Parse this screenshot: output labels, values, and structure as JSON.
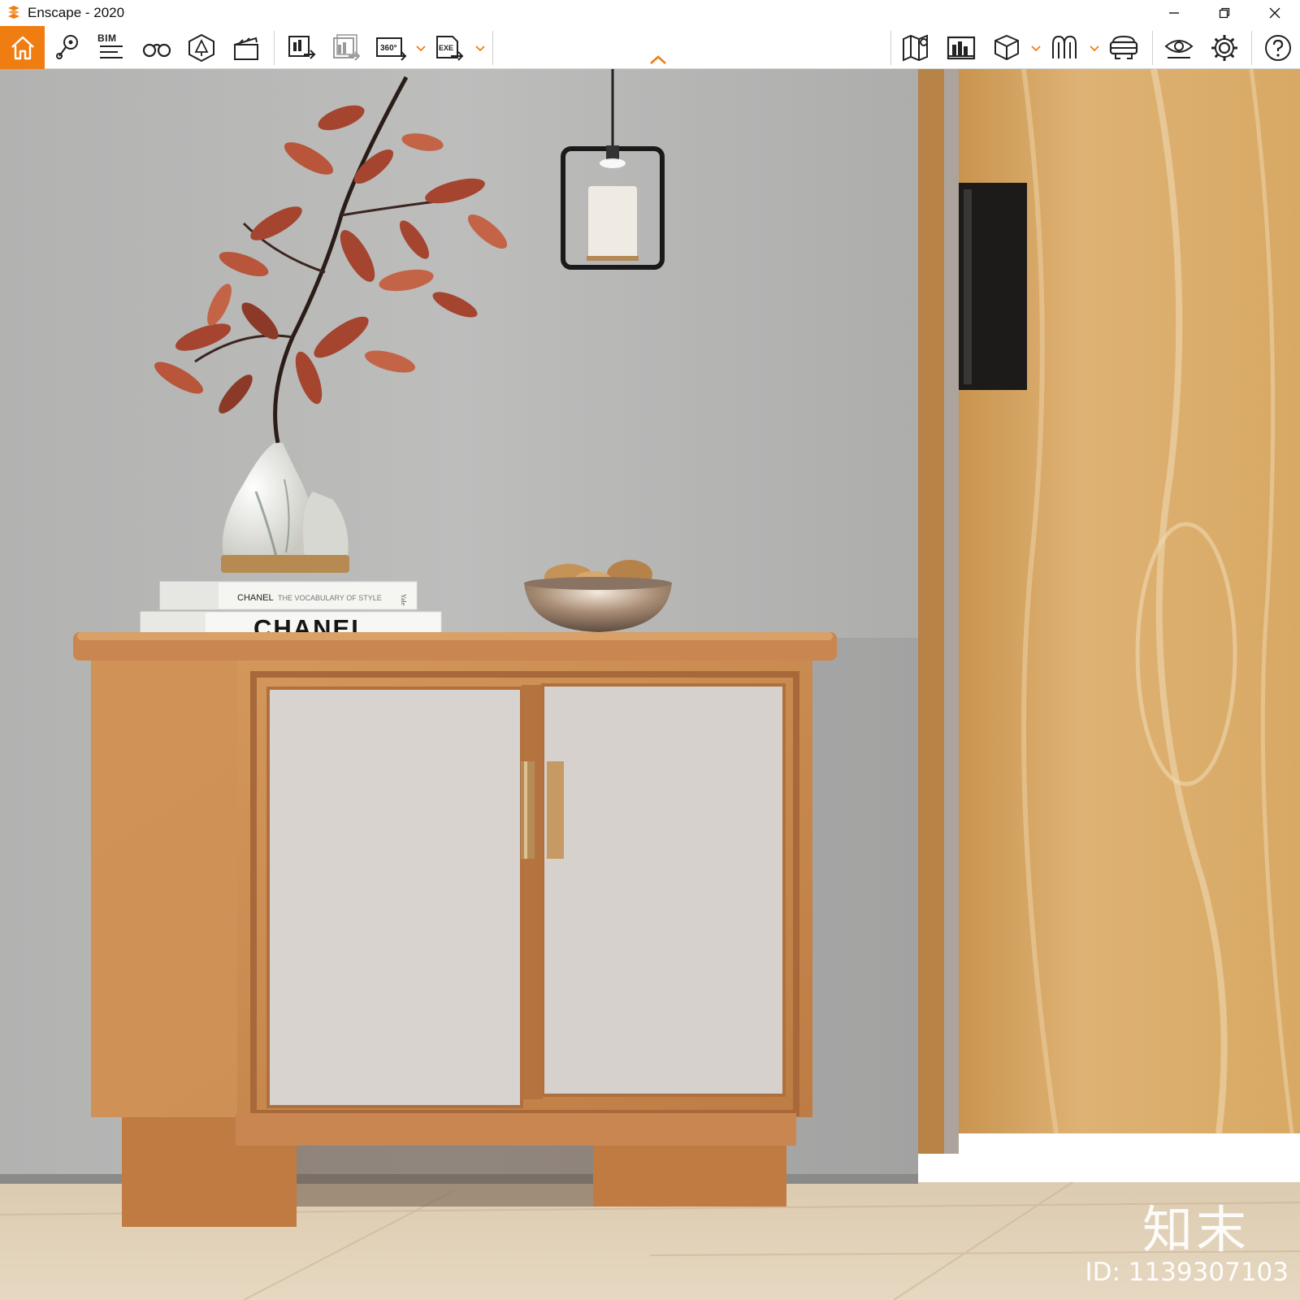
{
  "window": {
    "title": "Enscape - 2020",
    "controls": [
      "minimize-icon",
      "restore-icon",
      "close-icon"
    ]
  },
  "toolbar": {
    "bim_label": "BIM",
    "accent_color": "#f07d12",
    "left_group": [
      "home-icon",
      "location-pin-icon",
      "bim-list-icon",
      "binoculars-icon",
      "asset-library-icon",
      "clapperboard-icon"
    ],
    "export_group": [
      "screenshot-export-icon",
      "batch-render-icon",
      "panorama-360-icon",
      "exe-export-icon"
    ],
    "right_group": [
      "map-icon",
      "site-context-icon",
      "cube-view-icon",
      "visual-settings-icon",
      "vr-headset-icon",
      "view-visibility-icon",
      "settings-gear-icon",
      "help-icon"
    ],
    "panorama_badge": "360°",
    "exe_badge": "EXE"
  },
  "scene": {
    "book_top_title": "CHANEL",
    "book_top_subtitle": "THE VOCABULARY OF STYLE",
    "book_top_spine_mark": "Yale",
    "book_bottom_title": "CHANEL",
    "watermark_brand": "知末",
    "watermark_id": "ID: 1139307103",
    "colors": {
      "wall": "#b9b9b8",
      "cabinet_wood": "#c98a52",
      "door_panel": "#d8d3cf",
      "floor": "#d9c7ab",
      "door_wood": "#d6a763"
    }
  }
}
